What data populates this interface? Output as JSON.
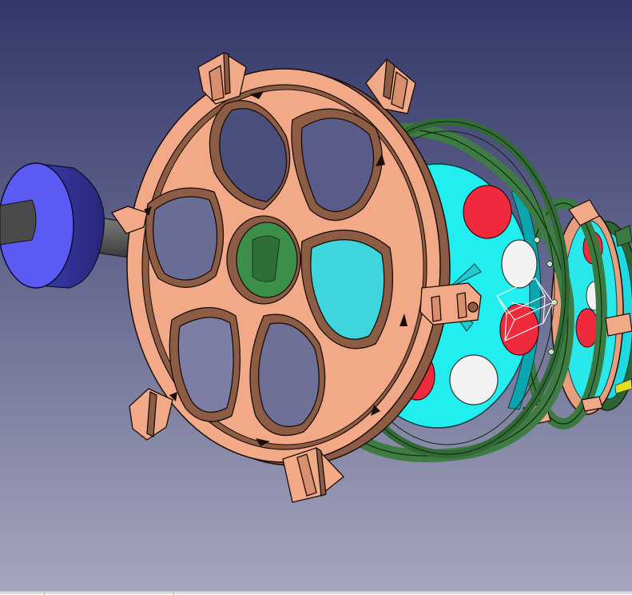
{
  "app": {
    "name": "3D CAD viewport",
    "background_top": "#3a3d6e",
    "background_bottom": "#a8a8bf"
  },
  "model": {
    "colors": {
      "frame_face": "#f1a987",
      "frame_side": "#8d5c44",
      "frame_edge": "#1a0d08",
      "green_ring": "#3f7c43",
      "green_ring_dark": "#254e29",
      "cyan_disc": "#22eef0",
      "cyan_dark": "#0aa6b0",
      "red_hole": "#ee2a3c",
      "white_hole": "#f2f2f2",
      "shaft": "#5a5a5a",
      "shaft_light": "#8e8e8e",
      "blue_cap": "#5b5bf4",
      "blue_cap_side": "#30308f"
    },
    "parts": [
      "blue-cap",
      "grey-shaft",
      "front-spoked-frame",
      "green-ring",
      "cyan-disc",
      "rear-frames",
      "selection-box"
    ]
  },
  "statusbar": {
    "segments": 3
  }
}
